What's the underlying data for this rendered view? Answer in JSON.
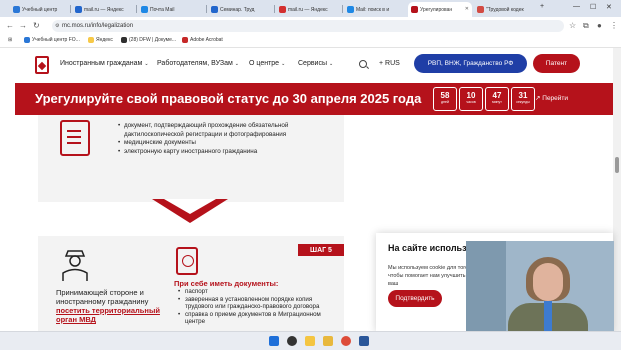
{
  "browser": {
    "tabs": [
      {
        "title": "Учебный центр",
        "favicon_color": "#2a77d6"
      },
      {
        "title": "mail.ru — Яндекс",
        "favicon_color": "#2266cc"
      },
      {
        "title": "Почта Mail",
        "favicon_color": "#1e88e5"
      },
      {
        "title": "Семинар. Труд",
        "favicon_color": "#2266cc"
      },
      {
        "title": "mail.ru — Яндекс",
        "favicon_color": "#d32f2f"
      },
      {
        "title": "Mail: поиск в и",
        "favicon_color": "#1e88e5"
      },
      {
        "title": "Урегулирован",
        "favicon_color": "#b5121b",
        "active": true
      },
      {
        "title": "\"Трудовой кодек",
        "favicon_color": "#d24a43"
      }
    ],
    "url": "mc.mos.ru/info/legalization",
    "bookmarks": [
      {
        "label": "Учебный центр FO...",
        "color": "#2a77d6"
      },
      {
        "label": "Яндекс",
        "color": "#f7c948"
      },
      {
        "label": "(28) DFW | Докуме...",
        "color": "#2f2f2f"
      },
      {
        "label": "Adobe Acrobat",
        "color": "#c62828"
      }
    ]
  },
  "site": {
    "menu": [
      {
        "label": "Иностранным гражданам"
      },
      {
        "label": "Работодателям, ВУЗам"
      },
      {
        "label": "О центре"
      },
      {
        "label": "Сервисы"
      }
    ],
    "lang": "+ RUS",
    "btn_primary": "РВП, ВНЖ, Гражданство РФ",
    "btn_patent": "Патент"
  },
  "banner": {
    "text": "Урегулируйте свой правовой статус до 30 апреля 2025 года",
    "countdown": [
      {
        "num": "58",
        "unit": "дней"
      },
      {
        "num": "10",
        "unit": "часов"
      },
      {
        "num": "47",
        "unit": "минут"
      },
      {
        "num": "31",
        "unit": "секунды"
      }
    ],
    "goto": "Перейти"
  },
  "step4": {
    "items": [
      "документ, подтверждающий прохождение обязательной дактилоскопической регистрации и фотографирования",
      "медицинские документы",
      "электронную карту иностранного гражданина"
    ]
  },
  "step5": {
    "tag": "ШАГ 5",
    "person_text_plain": "Принимающей стороне и иностранному гражданину",
    "person_text_link": "посетить территориальный орган МВД",
    "take_title": "При себе иметь документы:",
    "take_items": [
      "паспорт",
      "заверенная в установленном порядке копия трудового или гражданско-правового договора",
      "справка о приеме документов в Миграционном центре"
    ]
  },
  "cookie": {
    "title": "На сайте используются файлы Cookie",
    "text": "Мы используем cookie для того, чтобы помогает нам улучшить ваш",
    "button": "Подтвердить"
  }
}
